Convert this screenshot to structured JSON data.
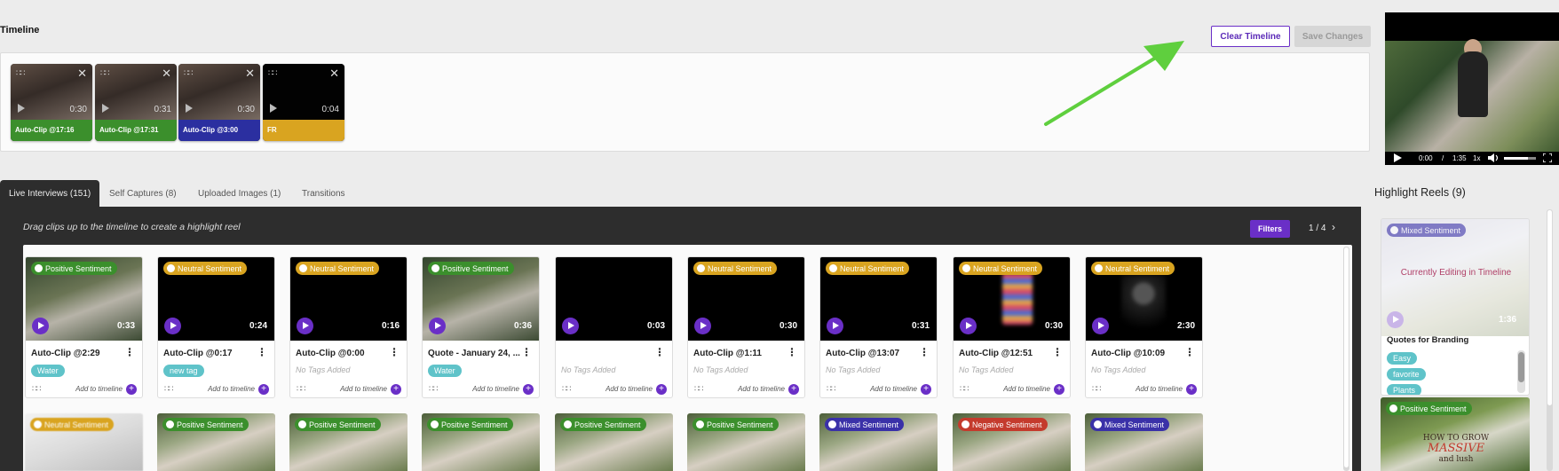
{
  "timeline": {
    "title": "Timeline",
    "clear_label": "Clear Timeline",
    "save_label": "Save Changes",
    "clips": [
      {
        "label": "Auto-Clip @17:16",
        "duration": "0:30",
        "color": "#3b8f2c"
      },
      {
        "label": "Auto-Clip @17:31",
        "duration": "0:31",
        "color": "#3b8f2c"
      },
      {
        "label": "Auto-Clip @3:00",
        "duration": "0:30",
        "color": "#2b2fa0"
      },
      {
        "label": "FR",
        "duration": "0:04",
        "color": "#d9a420"
      }
    ]
  },
  "player": {
    "time_current": "0:00",
    "time_sep": "/",
    "time_total": "1:35",
    "speed": "1x",
    "volume_level": 0.75
  },
  "tabs": [
    {
      "label": "Live Interviews (151)",
      "active": true
    },
    {
      "label": "Self Captures (8)",
      "active": false
    },
    {
      "label": "Uploaded Images (1)",
      "active": false
    },
    {
      "label": "Transitions",
      "active": false
    }
  ],
  "library": {
    "hint": "Drag clips up to the timeline to create a highlight reel",
    "filters_label": "Filters",
    "page_current": "1",
    "page_sep": "/",
    "page_total": "4",
    "add_label": "Add to timeline",
    "no_tags_label": "No Tags Added",
    "cards": [
      {
        "sentiment": "Positive Sentiment",
        "sclass": "sent-positive",
        "duration": "0:33",
        "title": "Auto-Clip @2:29",
        "tag": "Water",
        "vid": "scene"
      },
      {
        "sentiment": "Neutral Sentiment",
        "sclass": "sent-neutral",
        "duration": "0:24",
        "title": "Auto-Clip @0:17",
        "tag": "new tag",
        "vid": "black"
      },
      {
        "sentiment": "Neutral Sentiment",
        "sclass": "sent-neutral",
        "duration": "0:16",
        "title": "Auto-Clip @0:00",
        "tag": "",
        "vid": "black"
      },
      {
        "sentiment": "Positive Sentiment",
        "sclass": "sent-positive",
        "duration": "0:36",
        "title": "Quote - January 24, ...",
        "tag": "Water",
        "vid": "scene"
      },
      {
        "sentiment": "",
        "sclass": "",
        "duration": "0:03",
        "title": "",
        "tag": "",
        "vid": "black"
      },
      {
        "sentiment": "Neutral Sentiment",
        "sclass": "sent-neutral",
        "duration": "0:30",
        "title": "Auto-Clip @1:11",
        "tag": "",
        "vid": "black"
      },
      {
        "sentiment": "Neutral Sentiment",
        "sclass": "sent-neutral",
        "duration": "0:31",
        "title": "Auto-Clip @13:07",
        "tag": "",
        "vid": "black"
      },
      {
        "sentiment": "Neutral Sentiment",
        "sclass": "sent-neutral",
        "duration": "0:30",
        "title": "Auto-Clip @12:51",
        "tag": "",
        "vid": "phone"
      },
      {
        "sentiment": "Neutral Sentiment",
        "sclass": "sent-neutral",
        "duration": "2:30",
        "title": "Auto-Clip @10:09",
        "tag": "",
        "vid": "blur"
      }
    ],
    "row2": [
      {
        "sentiment": "Neutral Sentiment",
        "sclass": "sent-neutral",
        "blurry": true
      },
      {
        "sentiment": "Positive Sentiment",
        "sclass": "sent-positive",
        "blurry": false
      },
      {
        "sentiment": "Positive Sentiment",
        "sclass": "sent-positive",
        "blurry": false
      },
      {
        "sentiment": "Positive Sentiment",
        "sclass": "sent-positive",
        "blurry": false
      },
      {
        "sentiment": "Positive Sentiment",
        "sclass": "sent-positive",
        "blurry": false
      },
      {
        "sentiment": "Positive Sentiment",
        "sclass": "sent-positive",
        "blurry": false
      },
      {
        "sentiment": "Mixed Sentiment",
        "sclass": "sent-mixed",
        "blurry": false
      },
      {
        "sentiment": "Negative Sentiment",
        "sclass": "sent-negative",
        "blurry": false
      },
      {
        "sentiment": "Mixed Sentiment",
        "sclass": "sent-mixed",
        "blurry": false
      }
    ]
  },
  "highlight_reels": {
    "title": "Highlight Reels (9)",
    "reel1": {
      "sentiment": "Mixed Sentiment",
      "editing_label": "Currently Editing in Timeline",
      "duration": "1:36",
      "name": "Quotes for Branding",
      "tags": [
        "Easy",
        "favorite",
        "Plants"
      ]
    },
    "reel2": {
      "sentiment": "Positive Sentiment",
      "thumb_line1": "HOW TO GROW",
      "thumb_line2": "MASSIVE",
      "thumb_line3": "and lush"
    }
  }
}
